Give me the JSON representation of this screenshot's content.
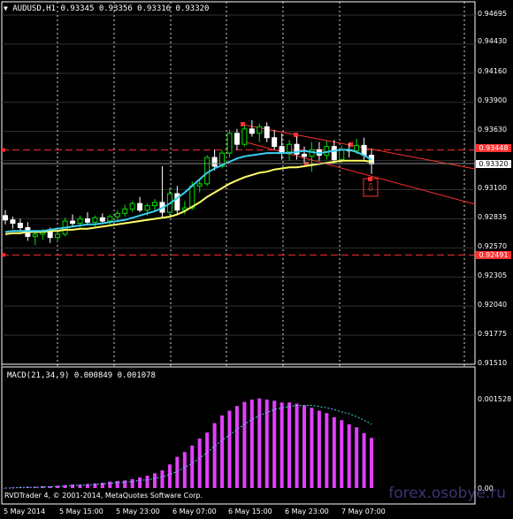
{
  "header": {
    "symbol": "AUDUSD,H1",
    "open": "0.93345",
    "high": "0.93356",
    "low": "0.93316",
    "close": "0.93320"
  },
  "price_axis": {
    "ticks": [
      "0.94695",
      "0.94430",
      "0.94160",
      "0.93900",
      "0.93630",
      "0.93100",
      "0.92835",
      "0.92570",
      "0.92305",
      "0.92040",
      "0.91775",
      "0.91510"
    ]
  },
  "price_tags": {
    "top_red": "0.93448",
    "current": "0.93320",
    "bottom_red": "0.92491"
  },
  "time_axis": {
    "labels": [
      "5 May 2014",
      "5 May 15:00",
      "5 May 23:00",
      "6 May 07:00",
      "6 May 15:00",
      "6 May 23:00",
      "7 May 07:00"
    ]
  },
  "macd": {
    "label": "MACD(21,34,9) 0.000849 0.001078",
    "ticks": [
      "0.001528",
      "0.00"
    ],
    "colors": {
      "histogram": "#e040fb",
      "signal": "#4fd6e8"
    }
  },
  "copyright": "RVDTrader 4, © 2001-2014, MetaQuotes Software Corp.",
  "watermark": "forex.osobye.ru",
  "colors": {
    "bull": "#00e000",
    "bear": "#ffffff",
    "ma_fast": "#3ad0f0",
    "ma_slow": "#ffff66",
    "level": "#ff3030"
  },
  "chart_data": {
    "type": "candlestick",
    "candles": [
      [
        0.9285,
        0.929,
        0.9277,
        0.9281
      ],
      [
        0.9281,
        0.9284,
        0.9273,
        0.9278
      ],
      [
        0.9278,
        0.9282,
        0.927,
        0.9274
      ],
      [
        0.9274,
        0.9279,
        0.9262,
        0.9266
      ],
      [
        0.9266,
        0.9272,
        0.9258,
        0.9268
      ],
      [
        0.9268,
        0.9273,
        0.9263,
        0.927
      ],
      [
        0.927,
        0.9274,
        0.926,
        0.9265
      ],
      [
        0.9265,
        0.927,
        0.9261,
        0.9268
      ],
      [
        0.9268,
        0.9283,
        0.9266,
        0.928
      ],
      [
        0.928,
        0.9286,
        0.9275,
        0.9278
      ],
      [
        0.9278,
        0.9285,
        0.9274,
        0.9282
      ],
      [
        0.9282,
        0.9288,
        0.9276,
        0.9279
      ],
      [
        0.9279,
        0.9285,
        0.9275,
        0.9283
      ],
      [
        0.9283,
        0.9287,
        0.9277,
        0.928
      ],
      [
        0.928,
        0.9286,
        0.9276,
        0.9284
      ],
      [
        0.9284,
        0.929,
        0.9281,
        0.9287
      ],
      [
        0.9287,
        0.9295,
        0.9284,
        0.9291
      ],
      [
        0.9291,
        0.9298,
        0.9288,
        0.9296
      ],
      [
        0.9296,
        0.9302,
        0.9288,
        0.929
      ],
      [
        0.929,
        0.9296,
        0.9285,
        0.9294
      ],
      [
        0.9294,
        0.93,
        0.9289,
        0.9297
      ],
      [
        0.9297,
        0.933,
        0.9283,
        0.9288
      ],
      [
        0.9288,
        0.931,
        0.9283,
        0.9305
      ],
      [
        0.9305,
        0.9312,
        0.9286,
        0.929
      ],
      [
        0.929,
        0.9298,
        0.9286,
        0.9292
      ],
      [
        0.9292,
        0.9316,
        0.929,
        0.9312
      ],
      [
        0.9312,
        0.9319,
        0.9306,
        0.9314
      ],
      [
        0.9314,
        0.934,
        0.9312,
        0.9338
      ],
      [
        0.9338,
        0.9345,
        0.9326,
        0.933
      ],
      [
        0.933,
        0.9345,
        0.9328,
        0.9342
      ],
      [
        0.9342,
        0.9363,
        0.9338,
        0.936
      ],
      [
        0.936,
        0.9364,
        0.9345,
        0.935
      ],
      [
        0.935,
        0.9367,
        0.9348,
        0.9364
      ],
      [
        0.9364,
        0.9372,
        0.9357,
        0.936
      ],
      [
        0.936,
        0.9369,
        0.9352,
        0.9366
      ],
      [
        0.9366,
        0.937,
        0.9352,
        0.9356
      ],
      [
        0.9356,
        0.9363,
        0.9345,
        0.9348
      ],
      [
        0.9348,
        0.936,
        0.9336,
        0.9343
      ],
      [
        0.9343,
        0.9354,
        0.9335,
        0.935
      ],
      [
        0.935,
        0.9357,
        0.9336,
        0.9341
      ],
      [
        0.9341,
        0.9348,
        0.9333,
        0.9339
      ],
      [
        0.9339,
        0.9352,
        0.9325,
        0.9345
      ],
      [
        0.9345,
        0.9352,
        0.9335,
        0.934
      ],
      [
        0.934,
        0.9353,
        0.9336,
        0.9348
      ],
      [
        0.9348,
        0.9354,
        0.9332,
        0.9336
      ],
      [
        0.9336,
        0.9349,
        0.9333,
        0.9345
      ],
      [
        0.9345,
        0.9351,
        0.9338,
        0.9344
      ],
      [
        0.9344,
        0.9355,
        0.9341,
        0.9349
      ],
      [
        0.9349,
        0.9356,
        0.9336,
        0.934
      ],
      [
        0.934,
        0.9346,
        0.9323,
        0.9332
      ]
    ],
    "ma_fast": [
      0.927,
      0.9271,
      0.9271,
      0.9271,
      0.9271,
      0.9271,
      0.9272,
      0.9273,
      0.9274,
      0.9275,
      0.9276,
      0.9277,
      0.9277,
      0.9278,
      0.9279,
      0.928,
      0.9281,
      0.9283,
      0.9285,
      0.9287,
      0.9289,
      0.9292,
      0.9296,
      0.9301,
      0.9306,
      0.9312,
      0.9318,
      0.9324,
      0.9328,
      0.9331,
      0.9334,
      0.9337,
      0.9339,
      0.934,
      0.9341,
      0.9342,
      0.9342,
      0.9342,
      0.9342,
      0.9343,
      0.9344,
      0.9343,
      0.9342,
      0.9343,
      0.9344,
      0.9345,
      0.9345,
      0.9343,
      0.934,
      0.9336
    ],
    "ma_slow": [
      0.9268,
      0.9269,
      0.9269,
      0.927,
      0.927,
      0.927,
      0.9271,
      0.9271,
      0.9272,
      0.9272,
      0.9273,
      0.9273,
      0.9274,
      0.9275,
      0.9276,
      0.9277,
      0.9278,
      0.9279,
      0.928,
      0.9281,
      0.9282,
      0.9283,
      0.9284,
      0.9286,
      0.9289,
      0.9293,
      0.9297,
      0.9302,
      0.9306,
      0.931,
      0.9314,
      0.9317,
      0.932,
      0.9322,
      0.9324,
      0.9325,
      0.9327,
      0.9328,
      0.9329,
      0.9329,
      0.933,
      0.9331,
      0.9332,
      0.9333,
      0.9334,
      0.9335,
      0.9335,
      0.9335,
      0.9335,
      0.9334
    ],
    "macd_hist": [
      0.0,
      1e-05,
      1e-05,
      2e-05,
      2e-05,
      3e-05,
      3e-05,
      4e-05,
      5e-05,
      6e-05,
      6e-05,
      7e-05,
      8e-05,
      9e-05,
      0.00011,
      0.00012,
      0.00013,
      0.00015,
      0.00018,
      0.00021,
      0.00025,
      0.0003,
      0.0004,
      0.00053,
      0.00061,
      0.00072,
      0.00084,
      0.00094,
      0.0011,
      0.00123,
      0.00131,
      0.00139,
      0.00146,
      0.0015,
      0.00152,
      0.0015,
      0.00148,
      0.00145,
      0.00145,
      0.00143,
      0.0014,
      0.00136,
      0.00131,
      0.00127,
      0.0012,
      0.00115,
      0.00108,
      0.00103,
      0.00093,
      0.00085
    ],
    "macd_signal": [
      0.0,
      0.0,
      1e-05,
      1e-05,
      1e-05,
      2e-05,
      2e-05,
      3e-05,
      3e-05,
      4e-05,
      5e-05,
      5e-05,
      6e-05,
      7e-05,
      8e-05,
      9e-05,
      0.0001,
      0.00011,
      0.00013,
      0.00014,
      0.00016,
      0.00019,
      0.00023,
      0.00028,
      0.00035,
      0.00042,
      0.00051,
      0.0006,
      0.00071,
      0.00081,
      0.0009,
      0.00099,
      0.00108,
      0.00116,
      0.00123,
      0.00128,
      0.00133,
      0.00136,
      0.00138,
      0.0014,
      0.0014,
      0.0014,
      0.00138,
      0.00136,
      0.00133,
      0.00129,
      0.00126,
      0.00121,
      0.00115,
      0.00108
    ],
    "levels": [
      0.93448,
      0.92491
    ]
  }
}
